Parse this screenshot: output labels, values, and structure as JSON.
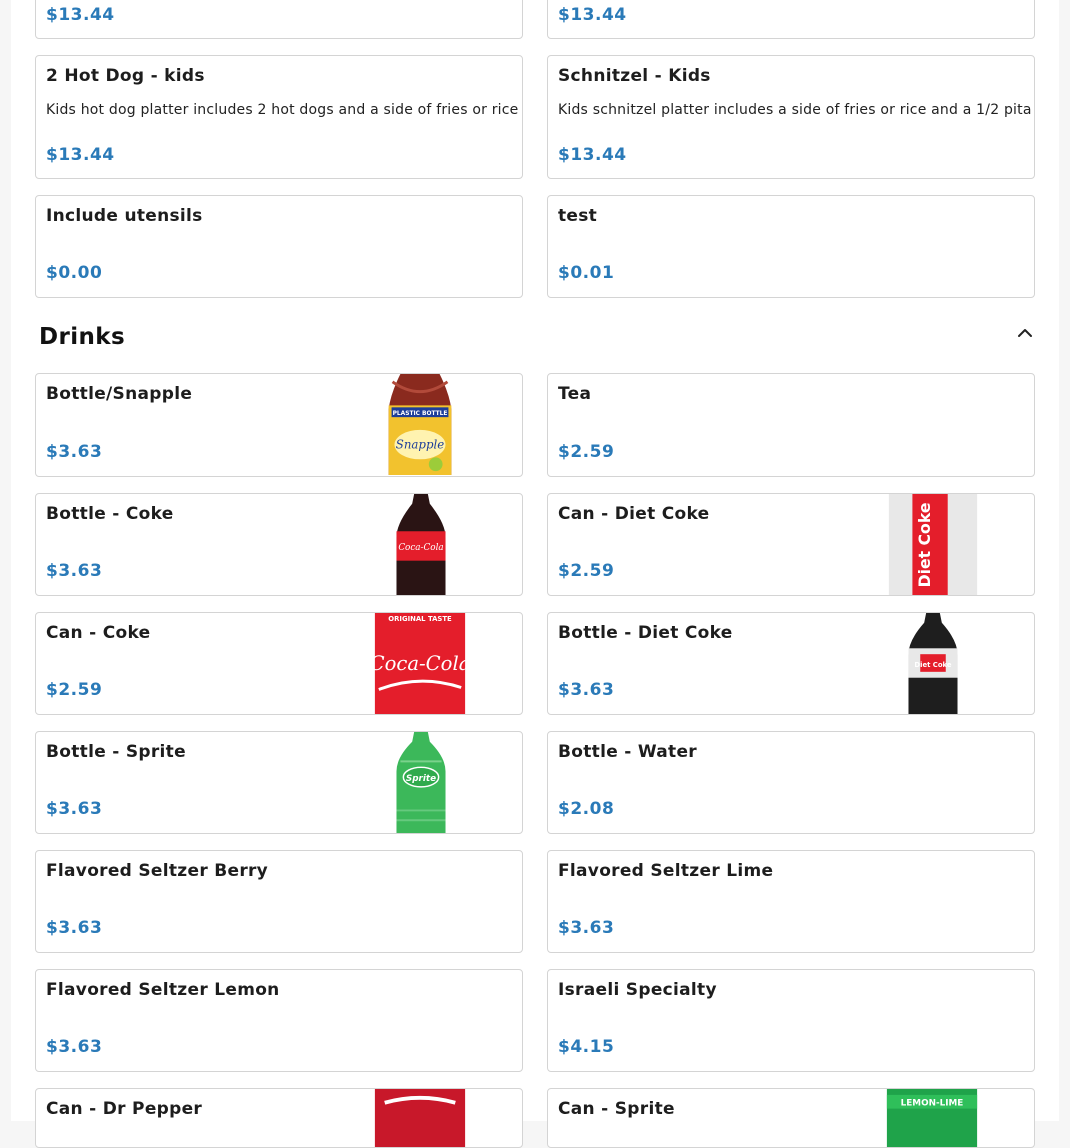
{
  "top_cards": [
    {
      "price": "$13.44"
    },
    {
      "price": "$13.44"
    }
  ],
  "kids": [
    {
      "name": "2 Hot Dog - kids",
      "description": "Kids hot dog platter includes 2 hot dogs and a side of fries or rice",
      "price": "$13.44"
    },
    {
      "name": "Schnitzel - Kids",
      "description": "Kids schnitzel platter includes a side of fries or rice and a 1/2 pita",
      "price": "$13.44"
    },
    {
      "name": "Include utensils",
      "price": "$0.00"
    },
    {
      "name": "test",
      "price": "$0.01"
    }
  ],
  "drinks": {
    "title": "Drinks",
    "collapse_icon": "chevron-up-icon",
    "items": [
      {
        "name": "Bottle/Snapple",
        "price": "$3.63",
        "image": "snapple-bottle"
      },
      {
        "name": "Tea",
        "price": "$2.59"
      },
      {
        "name": "Bottle - Coke",
        "price": "$3.63",
        "image": "coke-bottle"
      },
      {
        "name": "Can - Diet Coke",
        "price": "$2.59",
        "image": "diet-coke-can"
      },
      {
        "name": "Can - Coke",
        "price": "$2.59",
        "image": "coke-can"
      },
      {
        "name": "Bottle - Diet Coke",
        "price": "$3.63",
        "image": "diet-coke-bottle"
      },
      {
        "name": "Bottle - Sprite",
        "price": "$3.63",
        "image": "sprite-bottle"
      },
      {
        "name": "Bottle - Water",
        "price": "$2.08"
      },
      {
        "name": "Flavored Seltzer Berry",
        "price": "$3.63"
      },
      {
        "name": "Flavored Seltzer Lime",
        "price": "$3.63"
      },
      {
        "name": "Flavored Seltzer Lemon",
        "price": "$3.63"
      },
      {
        "name": "Israeli Specialty",
        "price": "$4.15"
      },
      {
        "name": "Can - Dr Pepper",
        "image": "dr-pepper-can"
      },
      {
        "name": "Can - Sprite",
        "image": "sprite-can"
      }
    ],
    "image_labels": {
      "snapple_top": "PLASTIC BOTTLE",
      "snapple_brand": "Snapple",
      "coke_brand": "Coca-Cola",
      "diet_coke_brand": "Diet Coke",
      "coke_can_top": "ORIGINAL TASTE",
      "sprite_brand": "Sprite",
      "sprite_can_band": "LEMON-LIME"
    }
  },
  "colors": {
    "price": "#2a7ab8",
    "border": "#d4d4d4",
    "coke_red": "#e41e2b",
    "sprite_green": "#2faa4c"
  }
}
